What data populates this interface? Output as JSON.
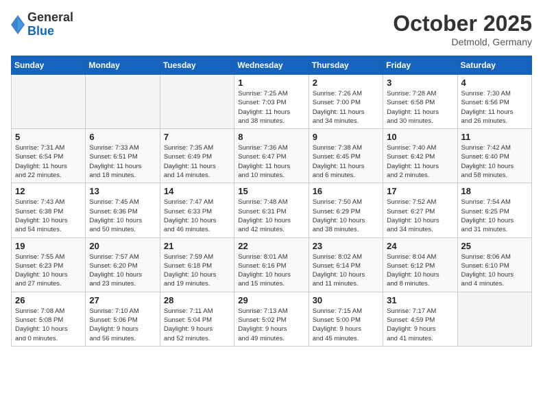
{
  "header": {
    "logo_general": "General",
    "logo_blue": "Blue",
    "month": "October 2025",
    "location": "Detmold, Germany"
  },
  "weekdays": [
    "Sunday",
    "Monday",
    "Tuesday",
    "Wednesday",
    "Thursday",
    "Friday",
    "Saturday"
  ],
  "weeks": [
    [
      {
        "day": "",
        "info": ""
      },
      {
        "day": "",
        "info": ""
      },
      {
        "day": "",
        "info": ""
      },
      {
        "day": "1",
        "info": "Sunrise: 7:25 AM\nSunset: 7:03 PM\nDaylight: 11 hours\nand 38 minutes."
      },
      {
        "day": "2",
        "info": "Sunrise: 7:26 AM\nSunset: 7:00 PM\nDaylight: 11 hours\nand 34 minutes."
      },
      {
        "day": "3",
        "info": "Sunrise: 7:28 AM\nSunset: 6:58 PM\nDaylight: 11 hours\nand 30 minutes."
      },
      {
        "day": "4",
        "info": "Sunrise: 7:30 AM\nSunset: 6:56 PM\nDaylight: 11 hours\nand 26 minutes."
      }
    ],
    [
      {
        "day": "5",
        "info": "Sunrise: 7:31 AM\nSunset: 6:54 PM\nDaylight: 11 hours\nand 22 minutes."
      },
      {
        "day": "6",
        "info": "Sunrise: 7:33 AM\nSunset: 6:51 PM\nDaylight: 11 hours\nand 18 minutes."
      },
      {
        "day": "7",
        "info": "Sunrise: 7:35 AM\nSunset: 6:49 PM\nDaylight: 11 hours\nand 14 minutes."
      },
      {
        "day": "8",
        "info": "Sunrise: 7:36 AM\nSunset: 6:47 PM\nDaylight: 11 hours\nand 10 minutes."
      },
      {
        "day": "9",
        "info": "Sunrise: 7:38 AM\nSunset: 6:45 PM\nDaylight: 11 hours\nand 6 minutes."
      },
      {
        "day": "10",
        "info": "Sunrise: 7:40 AM\nSunset: 6:42 PM\nDaylight: 11 hours\nand 2 minutes."
      },
      {
        "day": "11",
        "info": "Sunrise: 7:42 AM\nSunset: 6:40 PM\nDaylight: 10 hours\nand 58 minutes."
      }
    ],
    [
      {
        "day": "12",
        "info": "Sunrise: 7:43 AM\nSunset: 6:38 PM\nDaylight: 10 hours\nand 54 minutes."
      },
      {
        "day": "13",
        "info": "Sunrise: 7:45 AM\nSunset: 6:36 PM\nDaylight: 10 hours\nand 50 minutes."
      },
      {
        "day": "14",
        "info": "Sunrise: 7:47 AM\nSunset: 6:33 PM\nDaylight: 10 hours\nand 46 minutes."
      },
      {
        "day": "15",
        "info": "Sunrise: 7:48 AM\nSunset: 6:31 PM\nDaylight: 10 hours\nand 42 minutes."
      },
      {
        "day": "16",
        "info": "Sunrise: 7:50 AM\nSunset: 6:29 PM\nDaylight: 10 hours\nand 38 minutes."
      },
      {
        "day": "17",
        "info": "Sunrise: 7:52 AM\nSunset: 6:27 PM\nDaylight: 10 hours\nand 34 minutes."
      },
      {
        "day": "18",
        "info": "Sunrise: 7:54 AM\nSunset: 6:25 PM\nDaylight: 10 hours\nand 31 minutes."
      }
    ],
    [
      {
        "day": "19",
        "info": "Sunrise: 7:55 AM\nSunset: 6:23 PM\nDaylight: 10 hours\nand 27 minutes."
      },
      {
        "day": "20",
        "info": "Sunrise: 7:57 AM\nSunset: 6:20 PM\nDaylight: 10 hours\nand 23 minutes."
      },
      {
        "day": "21",
        "info": "Sunrise: 7:59 AM\nSunset: 6:18 PM\nDaylight: 10 hours\nand 19 minutes."
      },
      {
        "day": "22",
        "info": "Sunrise: 8:01 AM\nSunset: 6:16 PM\nDaylight: 10 hours\nand 15 minutes."
      },
      {
        "day": "23",
        "info": "Sunrise: 8:02 AM\nSunset: 6:14 PM\nDaylight: 10 hours\nand 11 minutes."
      },
      {
        "day": "24",
        "info": "Sunrise: 8:04 AM\nSunset: 6:12 PM\nDaylight: 10 hours\nand 8 minutes."
      },
      {
        "day": "25",
        "info": "Sunrise: 8:06 AM\nSunset: 6:10 PM\nDaylight: 10 hours\nand 4 minutes."
      }
    ],
    [
      {
        "day": "26",
        "info": "Sunrise: 7:08 AM\nSunset: 5:08 PM\nDaylight: 10 hours\nand 0 minutes."
      },
      {
        "day": "27",
        "info": "Sunrise: 7:10 AM\nSunset: 5:06 PM\nDaylight: 9 hours\nand 56 minutes."
      },
      {
        "day": "28",
        "info": "Sunrise: 7:11 AM\nSunset: 5:04 PM\nDaylight: 9 hours\nand 52 minutes."
      },
      {
        "day": "29",
        "info": "Sunrise: 7:13 AM\nSunset: 5:02 PM\nDaylight: 9 hours\nand 49 minutes."
      },
      {
        "day": "30",
        "info": "Sunrise: 7:15 AM\nSunset: 5:00 PM\nDaylight: 9 hours\nand 45 minutes."
      },
      {
        "day": "31",
        "info": "Sunrise: 7:17 AM\nSunset: 4:59 PM\nDaylight: 9 hours\nand 41 minutes."
      },
      {
        "day": "",
        "info": ""
      }
    ]
  ]
}
